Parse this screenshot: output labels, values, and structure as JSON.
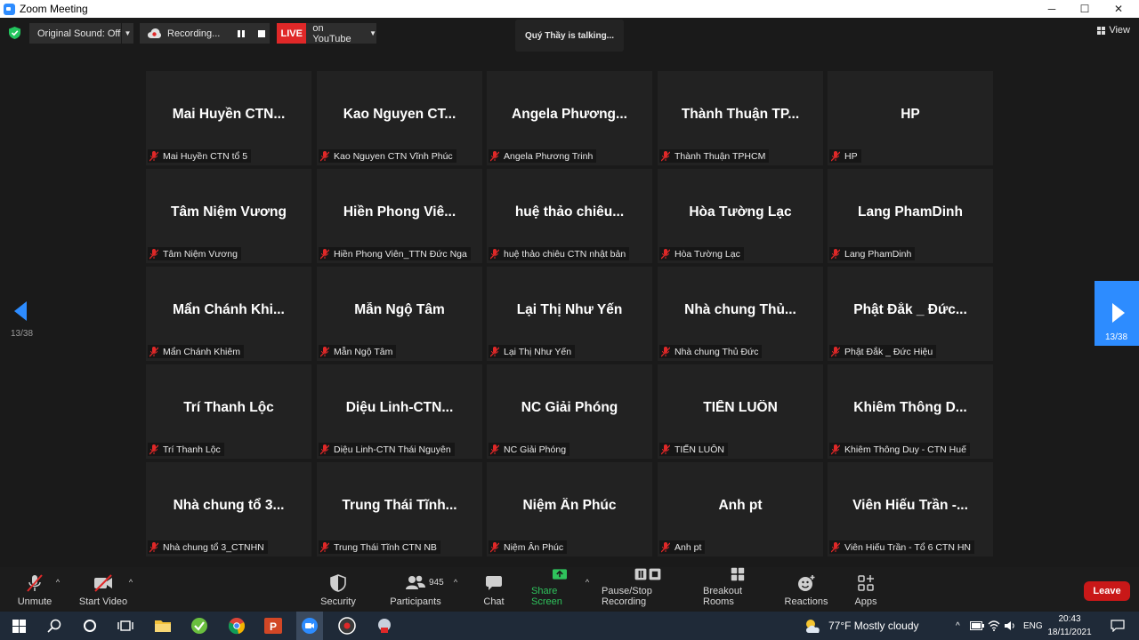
{
  "window": {
    "title": "Zoom Meeting",
    "minimize": "─",
    "maximize": "☐",
    "close": "✕"
  },
  "top_bar": {
    "original_sound": "Original Sound: Off",
    "recording": "Recording...",
    "live_badge": "LIVE",
    "live_target": "on YouTube",
    "talking_banner": "Quý Thầy is talking...",
    "view_label": "View"
  },
  "pager": {
    "left_page": "13/38",
    "right_page": "13/38"
  },
  "participants": [
    {
      "display": "Mai Huyền CTN...",
      "label": "Mai Huyền CTN tổ 5"
    },
    {
      "display": "Kao Nguyen CT...",
      "label": "Kao Nguyen CTN Vĩnh Phúc"
    },
    {
      "display": "Angela Phương...",
      "label": "Angela Phương Trinh"
    },
    {
      "display": "Thành Thuận TP...",
      "label": "Thành Thuận TPHCM"
    },
    {
      "display": "HP",
      "label": "HP"
    },
    {
      "display": "Tâm Niệm Vương",
      "label": "Tâm Niệm Vương"
    },
    {
      "display": "Hiền Phong Viê...",
      "label": "Hiền Phong Viên_TTN Đức Nga"
    },
    {
      "display": "huệ thảo chiêu...",
      "label": "huệ thảo chiêu CTN nhật bản"
    },
    {
      "display": "Hòa Tường Lạc",
      "label": "Hòa Tường Lạc"
    },
    {
      "display": "Lang PhamDinh",
      "label": "Lang PhamDinh"
    },
    {
      "display": "Mẩn Chánh Khi...",
      "label": "Mẩn Chánh Khiêm"
    },
    {
      "display": "Mẫn Ngộ Tâm",
      "label": "Mẫn Ngộ Tâm"
    },
    {
      "display": "Lại Thị Như Yến",
      "label": "Lại Thị Như Yến"
    },
    {
      "display": "Nhà chung Thủ...",
      "label": "Nhà chung Thủ Đức"
    },
    {
      "display": "Phật Đắk _ Đức...",
      "label": "Phật Đắk _ Đức Hiệu"
    },
    {
      "display": "Trí Thanh Lộc",
      "label": "Trí Thanh Lộc"
    },
    {
      "display": "Diệu Linh-CTN...",
      "label": "Diệu Linh-CTN Thái Nguyên"
    },
    {
      "display": "NC Giải Phóng",
      "label": "NC Giải Phóng"
    },
    {
      "display": "TIẾN LUÔN",
      "label": "TIẾN LUÔN"
    },
    {
      "display": "Khiêm Thông D...",
      "label": "Khiêm Thông Duy - CTN Huế"
    },
    {
      "display": "Nhà chung tổ 3...",
      "label": "Nhà chung tổ 3_CTNHN"
    },
    {
      "display": "Trung Thái Tĩnh...",
      "label": "Trung Thái Tĩnh CTN NB"
    },
    {
      "display": "Niệm Ân Phúc",
      "label": "Niệm Ân Phúc"
    },
    {
      "display": "Anh pt",
      "label": "Anh pt"
    },
    {
      "display": "Viên Hiếu Trần -...",
      "label": "Viên Hiếu Trần - Tổ 6 CTN HN"
    }
  ],
  "toolbar": {
    "unmute": "Unmute",
    "start_video": "Start Video",
    "security": "Security",
    "participants": "Participants",
    "participant_count": "945",
    "chat": "Chat",
    "share_screen": "Share Screen",
    "recording": "Pause/Stop Recording",
    "breakout": "Breakout Rooms",
    "reactions": "Reactions",
    "apps": "Apps",
    "leave": "Leave"
  },
  "taskbar": {
    "weather": "77°F  Mostly cloudy",
    "language": "ENG",
    "time": "20:43",
    "date": "18/11/2021"
  },
  "colors": {
    "accent": "#2d8cff",
    "live": "#e02828",
    "leave": "#c91818",
    "share": "#2fc35c",
    "mute": "#e02828"
  }
}
